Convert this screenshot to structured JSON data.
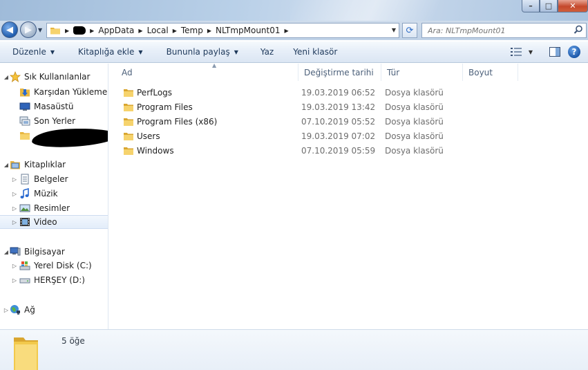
{
  "window": {
    "caption_buttons": {
      "minimize": "–",
      "maximize": "□",
      "close": "✕"
    }
  },
  "navigation": {
    "back_glyph": "◀",
    "forward_glyph": "▶",
    "breadcrumbs": [
      "AppData",
      "Local",
      "Temp",
      "NLTmpMount01"
    ],
    "search_placeholder": "Ara: NLTmpMount01",
    "refresh_glyph": "⟳"
  },
  "commandbar": {
    "items": [
      {
        "label": "Düzenle",
        "dropdown": true
      },
      {
        "label": "Kitaplığa ekle",
        "dropdown": true
      },
      {
        "label": "Bununla paylaş",
        "dropdown": true
      },
      {
        "label": "Yaz",
        "dropdown": false
      },
      {
        "label": "Yeni klasör",
        "dropdown": false
      }
    ],
    "help_glyph": "?"
  },
  "navpane": {
    "favorites": {
      "label": "Sık Kullanılanlar",
      "items": [
        {
          "label": "Karşıdan Yüklemeler",
          "icon": "downloads-icon"
        },
        {
          "label": "Masaüstü",
          "icon": "desktop-icon"
        },
        {
          "label": "Son Yerler",
          "icon": "recent-places-icon"
        }
      ]
    },
    "libraries": {
      "label": "Kitaplıklar",
      "items": [
        {
          "label": "Belgeler",
          "icon": "documents-icon"
        },
        {
          "label": "Müzik",
          "icon": "music-icon"
        },
        {
          "label": "Resimler",
          "icon": "pictures-icon"
        },
        {
          "label": "Video",
          "icon": "video-icon"
        }
      ]
    },
    "computer": {
      "label": "Bilgisayar",
      "items": [
        {
          "label": "Yerel Disk (C:)",
          "icon": "local-disk-icon"
        },
        {
          "label": "HERŞEY (D:)",
          "icon": "drive-icon"
        }
      ]
    },
    "network": {
      "label": "Ağ"
    }
  },
  "filelist": {
    "columns": {
      "name": "Ad",
      "date": "Değiştirme tarihi",
      "type": "Tür",
      "size": "Boyut"
    },
    "rows": [
      {
        "name": "PerfLogs",
        "date": "19.03.2019 06:52",
        "type": "Dosya klasörü"
      },
      {
        "name": "Program Files",
        "date": "19.03.2019 13:42",
        "type": "Dosya klasörü"
      },
      {
        "name": "Program Files (x86)",
        "date": "07.10.2019 05:52",
        "type": "Dosya klasörü"
      },
      {
        "name": "Users",
        "date": "19.03.2019 07:02",
        "type": "Dosya klasörü"
      },
      {
        "name": "Windows",
        "date": "07.10.2019 05:59",
        "type": "Dosya klasörü"
      }
    ]
  },
  "details": {
    "item_count": "5 öğe"
  },
  "colors": {
    "accent": "#1e395b",
    "selection": "#e3edfa",
    "folder": "#f2c94c"
  }
}
